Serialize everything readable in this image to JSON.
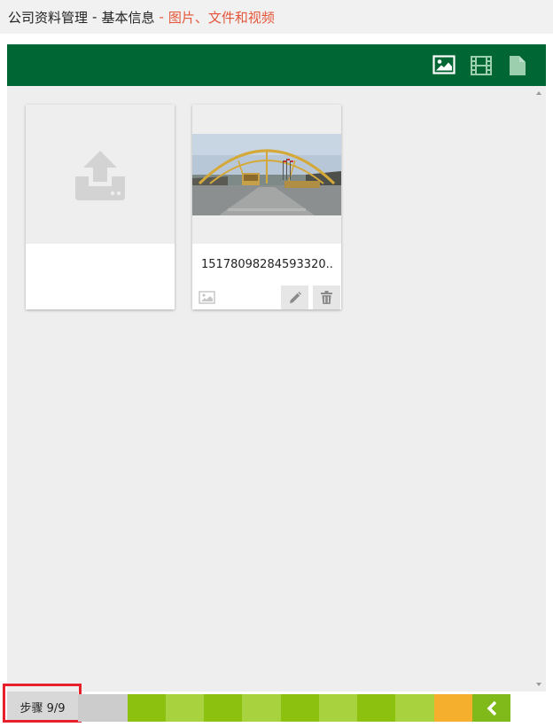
{
  "breadcrumb": {
    "section": "公司资料管理",
    "separator": "-",
    "subsection": "基本信息",
    "current": "图片、文件和视频"
  },
  "toolbar": {
    "icons": [
      "image-icon",
      "film-icon",
      "file-icon"
    ],
    "color": "#006633"
  },
  "gallery": {
    "upload_icon": "upload-icon",
    "items": [
      {
        "file_name": "15178098284593320...",
        "type_icon": "image-icon",
        "actions": [
          "pencil-icon",
          "trash-icon"
        ]
      }
    ]
  },
  "steps": {
    "label": "步骤 9/9",
    "total": 9,
    "current": 9,
    "colors": {
      "dark": "#8dc10f",
      "light": "#a9d33e",
      "orange": "#f6ae2d",
      "gray": "#cccccc"
    },
    "back_icon": "chevron-left-icon"
  },
  "accent_color": "#e4573b"
}
